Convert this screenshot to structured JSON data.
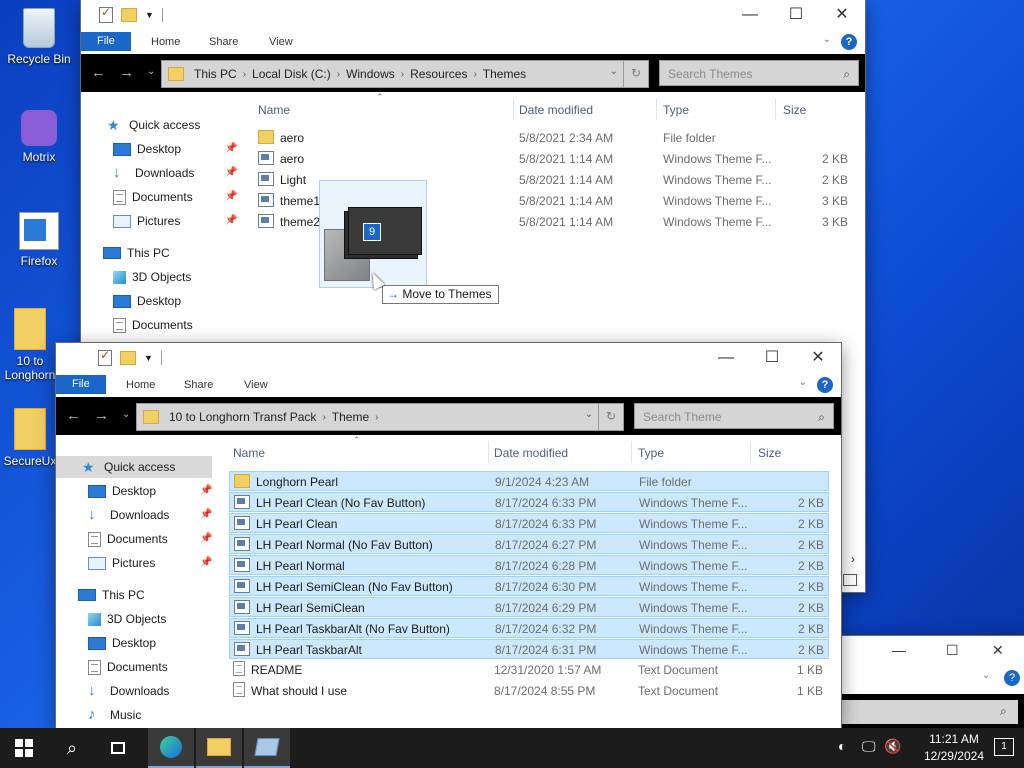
{
  "desktop": {
    "icons": [
      {
        "label": "Recycle Bin",
        "icon": "recycle-bin-icon"
      },
      {
        "label": "Motrix",
        "icon": "motrix-icon"
      },
      {
        "label": "Firefox",
        "icon": "firefox-icon"
      },
      {
        "label": "10 to Longhorn",
        "icon": "folder-icon"
      },
      {
        "label": "SecureUx",
        "icon": "secureux-icon"
      }
    ]
  },
  "ribbon": {
    "file": "File",
    "home": "Home",
    "share": "Share",
    "view": "View",
    "help": "?"
  },
  "window_controls": {
    "minimize": "—",
    "maximize": "☐",
    "close": "✕"
  },
  "win1": {
    "address": [
      "This PC",
      "Local Disk (C:)",
      "Windows",
      "Resources",
      "Themes"
    ],
    "search_placeholder": "Search Themes",
    "nav": {
      "quick_access": "Quick access",
      "items": [
        "Desktop",
        "Downloads",
        "Documents",
        "Pictures"
      ],
      "this_pc": "This PC",
      "pc_items": [
        "3D Objects",
        "Desktop",
        "Documents"
      ]
    },
    "columns": {
      "name": "Name",
      "date": "Date modified",
      "type": "Type",
      "size": "Size"
    },
    "files": [
      {
        "name": "aero",
        "date": "5/8/2021 2:34 AM",
        "type": "File folder",
        "size": "",
        "kind": "folder"
      },
      {
        "name": "aero",
        "date": "5/8/2021 1:14 AM",
        "type": "Windows Theme F...",
        "size": "2 KB",
        "kind": "theme"
      },
      {
        "name": "Light",
        "date": "5/8/2021 1:14 AM",
        "type": "Windows Theme F...",
        "size": "2 KB",
        "kind": "theme"
      },
      {
        "name": "theme1",
        "date": "5/8/2021 1:14 AM",
        "type": "Windows Theme F...",
        "size": "3 KB",
        "kind": "theme"
      },
      {
        "name": "theme2",
        "date": "5/8/2021 1:14 AM",
        "type": "Windows Theme F...",
        "size": "3 KB",
        "kind": "theme"
      }
    ]
  },
  "drag": {
    "count": "9",
    "tooltip": "Move to Themes"
  },
  "win2": {
    "address": [
      "10 to Longhorn Transf Pack",
      "Theme"
    ],
    "search_placeholder": "Search Theme",
    "nav": {
      "quick_access": "Quick access",
      "items": [
        "Desktop",
        "Downloads",
        "Documents",
        "Pictures"
      ],
      "this_pc": "This PC",
      "pc_items": [
        "3D Objects",
        "Desktop",
        "Documents",
        "Downloads",
        "Music"
      ]
    },
    "columns": {
      "name": "Name",
      "date": "Date modified",
      "type": "Type",
      "size": "Size"
    },
    "files": [
      {
        "name": "Longhorn Pearl",
        "date": "9/1/2024 4:23 AM",
        "type": "File folder",
        "size": "",
        "kind": "folder",
        "selected": true
      },
      {
        "name": "LH Pearl Clean (No Fav Button)",
        "date": "8/17/2024 6:33 PM",
        "type": "Windows Theme F...",
        "size": "2 KB",
        "kind": "theme",
        "selected": true
      },
      {
        "name": "LH Pearl Clean",
        "date": "8/17/2024 6:33 PM",
        "type": "Windows Theme F...",
        "size": "2 KB",
        "kind": "theme",
        "selected": true
      },
      {
        "name": "LH Pearl Normal (No Fav Button)",
        "date": "8/17/2024 6:27 PM",
        "type": "Windows Theme F...",
        "size": "2 KB",
        "kind": "theme",
        "selected": true
      },
      {
        "name": "LH Pearl Normal",
        "date": "8/17/2024 6:28 PM",
        "type": "Windows Theme F...",
        "size": "2 KB",
        "kind": "theme",
        "selected": true
      },
      {
        "name": "LH Pearl SemiClean (No Fav Button)",
        "date": "8/17/2024 6:30 PM",
        "type": "Windows Theme F...",
        "size": "2 KB",
        "kind": "theme",
        "selected": true
      },
      {
        "name": "LH Pearl SemiClean",
        "date": "8/17/2024 6:29 PM",
        "type": "Windows Theme F...",
        "size": "2 KB",
        "kind": "theme",
        "selected": true
      },
      {
        "name": "LH Pearl TaskbarAlt (No Fav Button)",
        "date": "8/17/2024 6:32 PM",
        "type": "Windows Theme F...",
        "size": "2 KB",
        "kind": "theme",
        "selected": true
      },
      {
        "name": "LH Pearl TaskbarAlt",
        "date": "8/17/2024 6:31 PM",
        "type": "Windows Theme F...",
        "size": "2 KB",
        "kind": "theme",
        "selected": true
      },
      {
        "name": "README",
        "date": "12/31/2020 1:57 AM",
        "type": "Text Document",
        "size": "1 KB",
        "kind": "text",
        "selected": false
      },
      {
        "name": "What should I use",
        "date": "8/17/2024 8:55 PM",
        "type": "Text Document",
        "size": "1 KB",
        "kind": "text",
        "selected": false
      }
    ]
  },
  "taskbar": {
    "time": "11:21 AM",
    "date": "12/29/2024",
    "notifications": "1"
  },
  "colors": {
    "accent": "#1a66c9",
    "selection": "#cce8ff",
    "desktop": "#1a63e8"
  }
}
